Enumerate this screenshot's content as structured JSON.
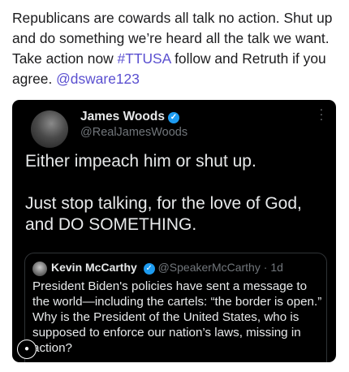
{
  "post": {
    "text_1": "Republicans are cowards all talk no action. Shut up and do something we’re heard all the talk we want. Take action now ",
    "hashtag": "#TTUSA",
    "text_2": " follow and Retruth if you agree. ",
    "mention": "@dsware123"
  },
  "embed": {
    "author_name": "James Woods",
    "author_handle": "@RealJamesWoods",
    "verified_icon": "verified-badge-icon",
    "body_line_1": "Either impeach him or shut up.",
    "body_line_2": "Just stop talking, for the love of God, and DO SOMETHING.",
    "quote": {
      "name": "Kevin McCarthy",
      "handle": "@SpeakerMcCarthy",
      "separator": "·",
      "time": "1d",
      "text": "President Biden's policies have sent a message to the world—including the cartels: “the border is open.”  Why is the President of the United States, who is supposed to enforce our nation’s laws, missing in action?"
    }
  },
  "colors": {
    "link": "#5a4fd0",
    "verified": "#1d9bf0",
    "embed_bg": "#000000"
  }
}
